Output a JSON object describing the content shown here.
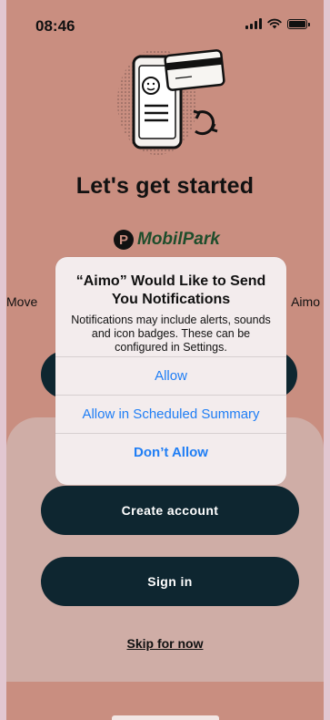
{
  "status_bar": {
    "time": "08:46",
    "icons": [
      "signal-icon",
      "wifi-icon",
      "battery-icon"
    ]
  },
  "onboarding": {
    "title": "Let's get started",
    "brand_name": "MobilPark",
    "behind_text_left": "Move",
    "behind_text_right": "Aimo",
    "create_account_label": "Create account",
    "sign_in_label": "Sign in",
    "skip_label": "Skip for now"
  },
  "alert": {
    "title": "“Aimo” Would Like to Send You Notifications",
    "message": "Notifications may include alerts, sounds and icon badges. These can be configured in Settings.",
    "actions": [
      {
        "label": "Allow"
      },
      {
        "label": "Allow in Scheduled Summary"
      },
      {
        "label": "Don’t Allow"
      }
    ]
  },
  "colors": {
    "background": "#c98e80",
    "sheet": "#cfada6",
    "button": "#0e2630",
    "alert_action": "#1f7ef5",
    "brand_green": "#1e4d2b"
  }
}
